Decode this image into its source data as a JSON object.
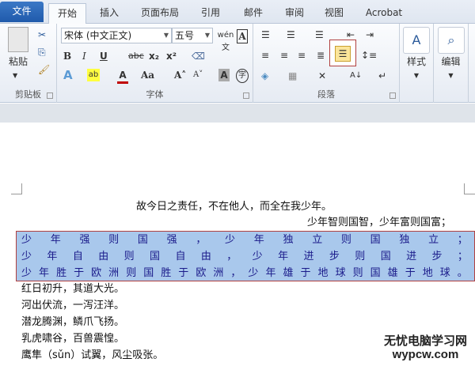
{
  "tabs": {
    "file": "文件",
    "home": "开始",
    "insert": "插入",
    "layout": "页面布局",
    "references": "引用",
    "mailings": "邮件",
    "review": "审阅",
    "view": "视图",
    "acrobat": "Acrobat"
  },
  "ribbon": {
    "clipboard": {
      "label": "剪贴板",
      "paste": "粘贴"
    },
    "font": {
      "label": "字体",
      "font_name": "宋体 (中文正文)",
      "font_size": "五号",
      "bold": "B",
      "italic": "I",
      "underline": "U",
      "strike": "abc",
      "sub": "x₂",
      "sup": "x²",
      "grow": "A˄",
      "shrink": "A˅",
      "case": "Aa",
      "shade": "A",
      "enclose": "字",
      "phonetic": "wén 文"
    },
    "paragraph": {
      "label": "段落"
    },
    "styles": {
      "label": "样式"
    },
    "editing": {
      "label": "编辑"
    }
  },
  "document": {
    "line1": "故今日之责任，不在他人，而全在我少年。",
    "line2": "少年智则国智，少年富则国富；",
    "selected": [
      [
        "少",
        "年",
        "强",
        "则",
        "国",
        "强",
        "，",
        "少",
        "年",
        "独",
        "立",
        "则",
        "国",
        "独",
        "立",
        "；"
      ],
      [
        "少",
        "年",
        "自",
        "由",
        "则",
        "国",
        "自",
        "由",
        "，",
        "少",
        "年",
        "进",
        "步",
        "则",
        "国",
        "进",
        "步",
        "；"
      ],
      [
        "少",
        "年",
        "胜",
        "于",
        "欧",
        "洲",
        "则",
        "国",
        "胜",
        "于",
        "欧",
        "洲",
        "，",
        "少",
        "年",
        "雄",
        "于",
        "地",
        "球",
        "则",
        "国",
        "雄",
        "于",
        "地",
        "球",
        "。"
      ]
    ],
    "rest": [
      "红日初升，其道大光。",
      "河出伏流，一泻汪洋。",
      "潜龙腾渊，鳞爪飞扬。",
      "乳虎啸谷，百兽震惶。",
      "鹰隼（sǔn）试翼，风尘吸张。"
    ]
  },
  "watermark": {
    "cn": "无忧电脑学习网",
    "url": "wypcw.com"
  }
}
